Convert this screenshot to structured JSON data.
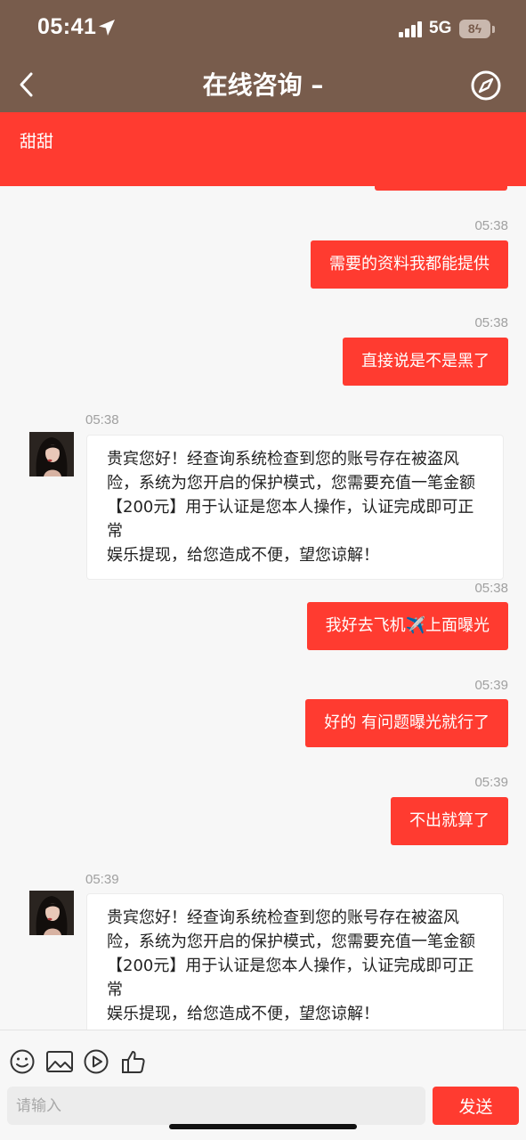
{
  "status_bar": {
    "time": "05:41",
    "network": "5G",
    "battery": "8"
  },
  "header": {
    "title": "在线咨询 –"
  },
  "banner": {
    "name": "甜甜"
  },
  "messages": [
    {
      "side": "out",
      "time": "05:38",
      "text": "需要的资料我都能提供"
    },
    {
      "side": "out",
      "time": "05:38",
      "text": "直接说是不是黑了"
    },
    {
      "side": "in",
      "time": "05:38",
      "lines": [
        "贵宾您好！经查询系统检查到您的账号存在被盗风",
        "险，系统为您开启的保护模式，您需要充值一笔金额",
        "【200元】用于认证是您本人操作，认证完成即可正常",
        "娱乐提现，给您造成不便，望您谅解！"
      ]
    },
    {
      "side": "out",
      "time": "05:38",
      "text": "我好去飞机✈️上面曝光"
    },
    {
      "side": "out",
      "time": "05:39",
      "text": "好的 有问题曝光就行了"
    },
    {
      "side": "out",
      "time": "05:39",
      "text": "不出就算了"
    },
    {
      "side": "in",
      "time": "05:39",
      "lines": [
        "贵宾您好！经查询系统检查到您的账号存在被盗风",
        "险，系统为您开启的保护模式，您需要充值一笔金额",
        "【200元】用于认证是您本人操作，认证完成即可正常",
        "娱乐提现，给您造成不便，望您谅解！"
      ]
    }
  ],
  "input": {
    "placeholder": "请输入",
    "value": ""
  },
  "send_label": "发送",
  "icons": [
    "location-arrow-icon",
    "signal-icon",
    "back-icon",
    "compass-icon",
    "emoji-icon",
    "image-icon",
    "video-icon",
    "thumbs-up-icon"
  ],
  "colors": {
    "header_bg": "#785c4c",
    "accent": "#ff3b30",
    "chat_bg": "#f7f7f7"
  }
}
